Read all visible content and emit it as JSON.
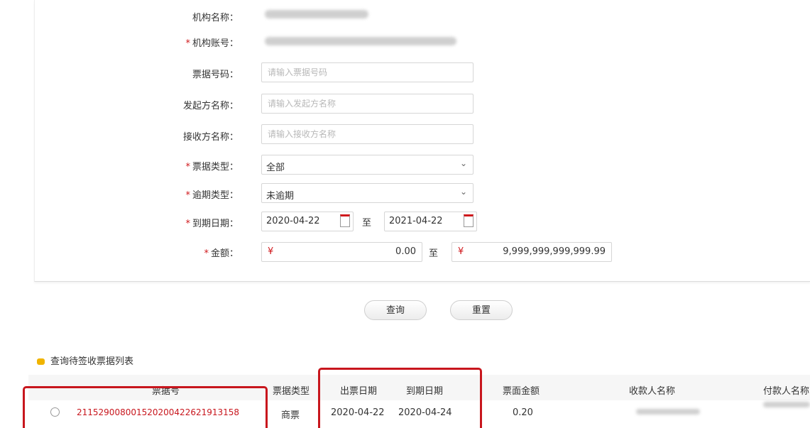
{
  "form": {
    "institution_name": {
      "label": "机构名称",
      "sep": "："
    },
    "institution_account": {
      "label": "机构账号",
      "sep": "：",
      "required": "*"
    },
    "bill_number": {
      "label": "票据号码",
      "sep": "：",
      "placeholder": "请输入票据号码"
    },
    "drawer_name": {
      "label": "发起方名称",
      "sep": "：",
      "placeholder": "请输入发起方名称"
    },
    "payee_name": {
      "label": "接收方名称",
      "sep": "：",
      "placeholder": "请输入接收方名称"
    },
    "bill_type": {
      "label": "票据类型",
      "sep": "：",
      "required": "*",
      "value": "全部"
    },
    "overdue_type": {
      "label": "逾期类型",
      "sep": "：",
      "required": "*",
      "value": "未逾期"
    },
    "due_date": {
      "label": "到期日期",
      "sep": "：",
      "required": "*",
      "from": "2020-04-22",
      "to_word": "至",
      "to": "2021-04-22"
    },
    "amount": {
      "label": "金额",
      "sep": "：",
      "required": "*",
      "currency": "¥",
      "from": "0.00",
      "to_word": "至",
      "to": "9,999,999,999,999.99"
    }
  },
  "buttons": {
    "query": "查询",
    "reset": "重置"
  },
  "list": {
    "title": "查询待签收票据列表",
    "columns": [
      "票据号",
      "票据类型",
      "出票日期",
      "到期日期",
      "票面金额",
      "收款人名称",
      "付款人名称"
    ],
    "rows": [
      {
        "bill_no": "211529008001520200422621913158",
        "type": "商票",
        "issue_date": "2020-04-22",
        "due_date": "2020-04-24",
        "amount": "0.20"
      }
    ]
  },
  "colors": {
    "accent": "#c8161d",
    "required": "#d0181c",
    "section_icon": "#f0b400"
  }
}
